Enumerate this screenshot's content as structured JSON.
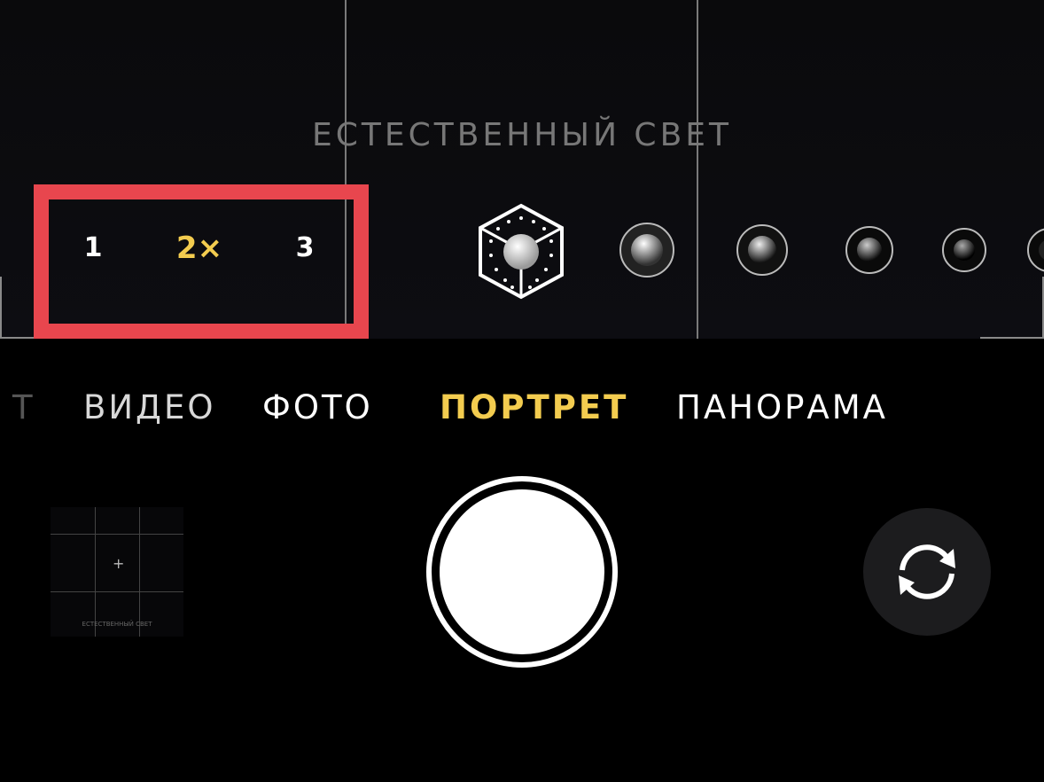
{
  "lighting": {
    "label": "ЕСТЕСТВЕННЫЙ СВЕТ"
  },
  "zoom": {
    "options": [
      {
        "label": "1",
        "active": false
      },
      {
        "label": "2×",
        "active": true
      },
      {
        "label": "3",
        "active": false
      }
    ]
  },
  "modes": [
    {
      "label": "Т",
      "active": false
    },
    {
      "label": "ВИДЕО",
      "active": false
    },
    {
      "label": "ФОТО",
      "active": false
    },
    {
      "label": "ПОРТРЕТ",
      "active": true
    },
    {
      "label": "ПАНОРАМА",
      "active": false
    }
  ],
  "thumbnail": {
    "caption": "ЕСТЕСТВЕННЫЙ СВЕТ"
  },
  "colors": {
    "accent": "#f3cc4f",
    "highlight_border": "#e8464e",
    "background": "#000000"
  },
  "icons": {
    "lighting_cube": "portrait-lighting-cube-icon",
    "flip": "camera-flip-icon"
  }
}
